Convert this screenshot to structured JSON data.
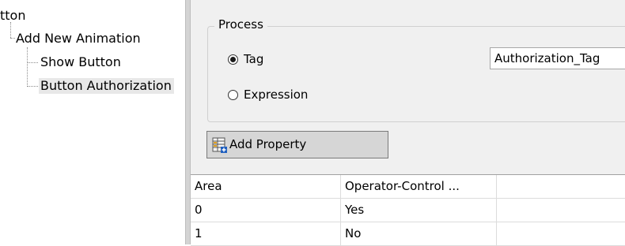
{
  "tree": {
    "root": "tton",
    "child": "Add New Animation",
    "items": [
      "Show Button",
      "Button Authorization"
    ]
  },
  "process": {
    "group_title": "Process",
    "options": [
      {
        "label": "Tag",
        "checked": true
      },
      {
        "label": "Expression",
        "checked": false
      }
    ],
    "tag_value": "Authorization_Tag"
  },
  "toolbar": {
    "add_property_label": "Add Property",
    "add_property_icon": "add-property-icon"
  },
  "grid": {
    "columns": [
      "Area",
      "Operator-Control ...",
      ""
    ],
    "rows": [
      [
        "0",
        "Yes",
        ""
      ],
      [
        "1",
        "No",
        ""
      ]
    ]
  }
}
